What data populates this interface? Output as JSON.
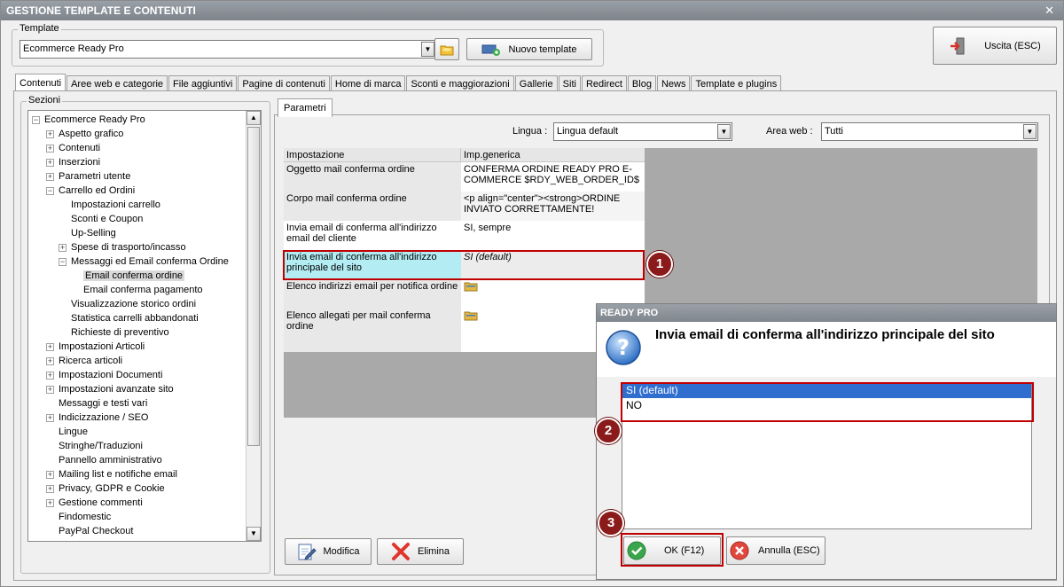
{
  "window": {
    "title": "GESTIONE TEMPLATE E CONTENUTI",
    "close": "✕"
  },
  "template_group": {
    "label": "Template",
    "selected": "Ecommerce Ready Pro",
    "new_template_label": "Nuovo template"
  },
  "exit_button": {
    "label": "Uscita (ESC)"
  },
  "tabs": [
    {
      "label": "Contenuti",
      "active": true
    },
    {
      "label": "Aree web e categorie"
    },
    {
      "label": "File aggiuntivi"
    },
    {
      "label": "Pagine di contenuti"
    },
    {
      "label": "Home di marca"
    },
    {
      "label": "Sconti e maggiorazioni"
    },
    {
      "label": "Gallerie"
    },
    {
      "label": "Siti"
    },
    {
      "label": "Redirect"
    },
    {
      "label": "Blog"
    },
    {
      "label": "News"
    },
    {
      "label": "Template e plugins"
    }
  ],
  "sections": {
    "label": "Sezioni",
    "tree": [
      {
        "label": "Ecommerce Ready Pro",
        "level": 0,
        "exp": "−"
      },
      {
        "label": "Aspetto grafico",
        "level": 1,
        "exp": "+"
      },
      {
        "label": "Contenuti",
        "level": 1,
        "exp": "+"
      },
      {
        "label": "Inserzioni",
        "level": 1,
        "exp": "+"
      },
      {
        "label": "Parametri utente",
        "level": 1,
        "exp": "+"
      },
      {
        "label": "Carrello ed Ordini",
        "level": 1,
        "exp": "−"
      },
      {
        "label": "Impostazioni carrello",
        "level": 2,
        "exp": ""
      },
      {
        "label": "Sconti e Coupon",
        "level": 2,
        "exp": ""
      },
      {
        "label": "Up-Selling",
        "level": 2,
        "exp": ""
      },
      {
        "label": "Spese di trasporto/incasso",
        "level": 2,
        "exp": "+"
      },
      {
        "label": "Messaggi ed Email conferma Ordine",
        "level": 2,
        "exp": "−"
      },
      {
        "label": "Email conferma ordine",
        "level": 3,
        "exp": "",
        "selected": true
      },
      {
        "label": "Email conferma pagamento",
        "level": 3,
        "exp": ""
      },
      {
        "label": "Visualizzazione storico ordini",
        "level": 2,
        "exp": ""
      },
      {
        "label": "Statistica carrelli abbandonati",
        "level": 2,
        "exp": ""
      },
      {
        "label": "Richieste di preventivo",
        "level": 2,
        "exp": ""
      },
      {
        "label": "Impostazioni Articoli",
        "level": 1,
        "exp": "+"
      },
      {
        "label": "Ricerca articoli",
        "level": 1,
        "exp": "+"
      },
      {
        "label": "Impostazioni Documenti",
        "level": 1,
        "exp": "+"
      },
      {
        "label": "Impostazioni avanzate sito",
        "level": 1,
        "exp": "+"
      },
      {
        "label": "Messaggi e testi vari",
        "level": 1,
        "exp": ""
      },
      {
        "label": "Indicizzazione / SEO",
        "level": 1,
        "exp": "+"
      },
      {
        "label": "Lingue",
        "level": 1,
        "exp": ""
      },
      {
        "label": "Stringhe/Traduzioni",
        "level": 1,
        "exp": ""
      },
      {
        "label": "Pannello amministrativo",
        "level": 1,
        "exp": ""
      },
      {
        "label": "Mailing list e notifiche email",
        "level": 1,
        "exp": "+"
      },
      {
        "label": "Privacy, GDPR e Cookie",
        "level": 1,
        "exp": "+"
      },
      {
        "label": "Gestione commenti",
        "level": 1,
        "exp": "+"
      },
      {
        "label": "Findomestic",
        "level": 1,
        "exp": ""
      },
      {
        "label": "PayPal Checkout",
        "level": 1,
        "exp": ""
      }
    ]
  },
  "params": {
    "tab_label": "Parametri",
    "lingua_label": "Lingua :",
    "lingua_value": "Lingua default",
    "area_label": "Area web :",
    "area_value": "Tutti",
    "headers": [
      "Impostazione",
      "Imp.generica"
    ],
    "rows": [
      {
        "setting": "Oggetto mail conferma ordine",
        "value": "CONFERMA ORDINE READY PRO E-COMMERCE $RDY_WEB_ORDER_ID$"
      },
      {
        "setting": "Corpo mail conferma ordine",
        "value": "<p align=\"center\"><strong>ORDINE INVIATO CORRETTAMENTE!"
      },
      {
        "setting": "Invia email di conferma all'indirizzo email del cliente",
        "value": "SI, sempre"
      },
      {
        "setting": "Invia email di conferma all'indirizzo principale del sito",
        "value": "SI (default)"
      },
      {
        "setting": "Elenco indirizzi email per notifica ordine",
        "value": ""
      },
      {
        "setting": "Elenco allegati per mail conferma ordine",
        "value": ""
      }
    ],
    "modify_label": "Modifica",
    "delete_label": "Elimina"
  },
  "dialog": {
    "title": "READY PRO",
    "question": "Invia email di conferma all'indirizzo principale del sito",
    "options": [
      "SI (default)",
      "NO"
    ],
    "ok_label": "OK (F12)",
    "cancel_label": "Annulla (ESC)"
  },
  "badges": [
    "1",
    "2",
    "3"
  ],
  "colors": {
    "callout": "#c00000",
    "badge": "#8b1a1a",
    "selection": "#2f6ecf",
    "highlight_cell": "#b3ecf2"
  }
}
